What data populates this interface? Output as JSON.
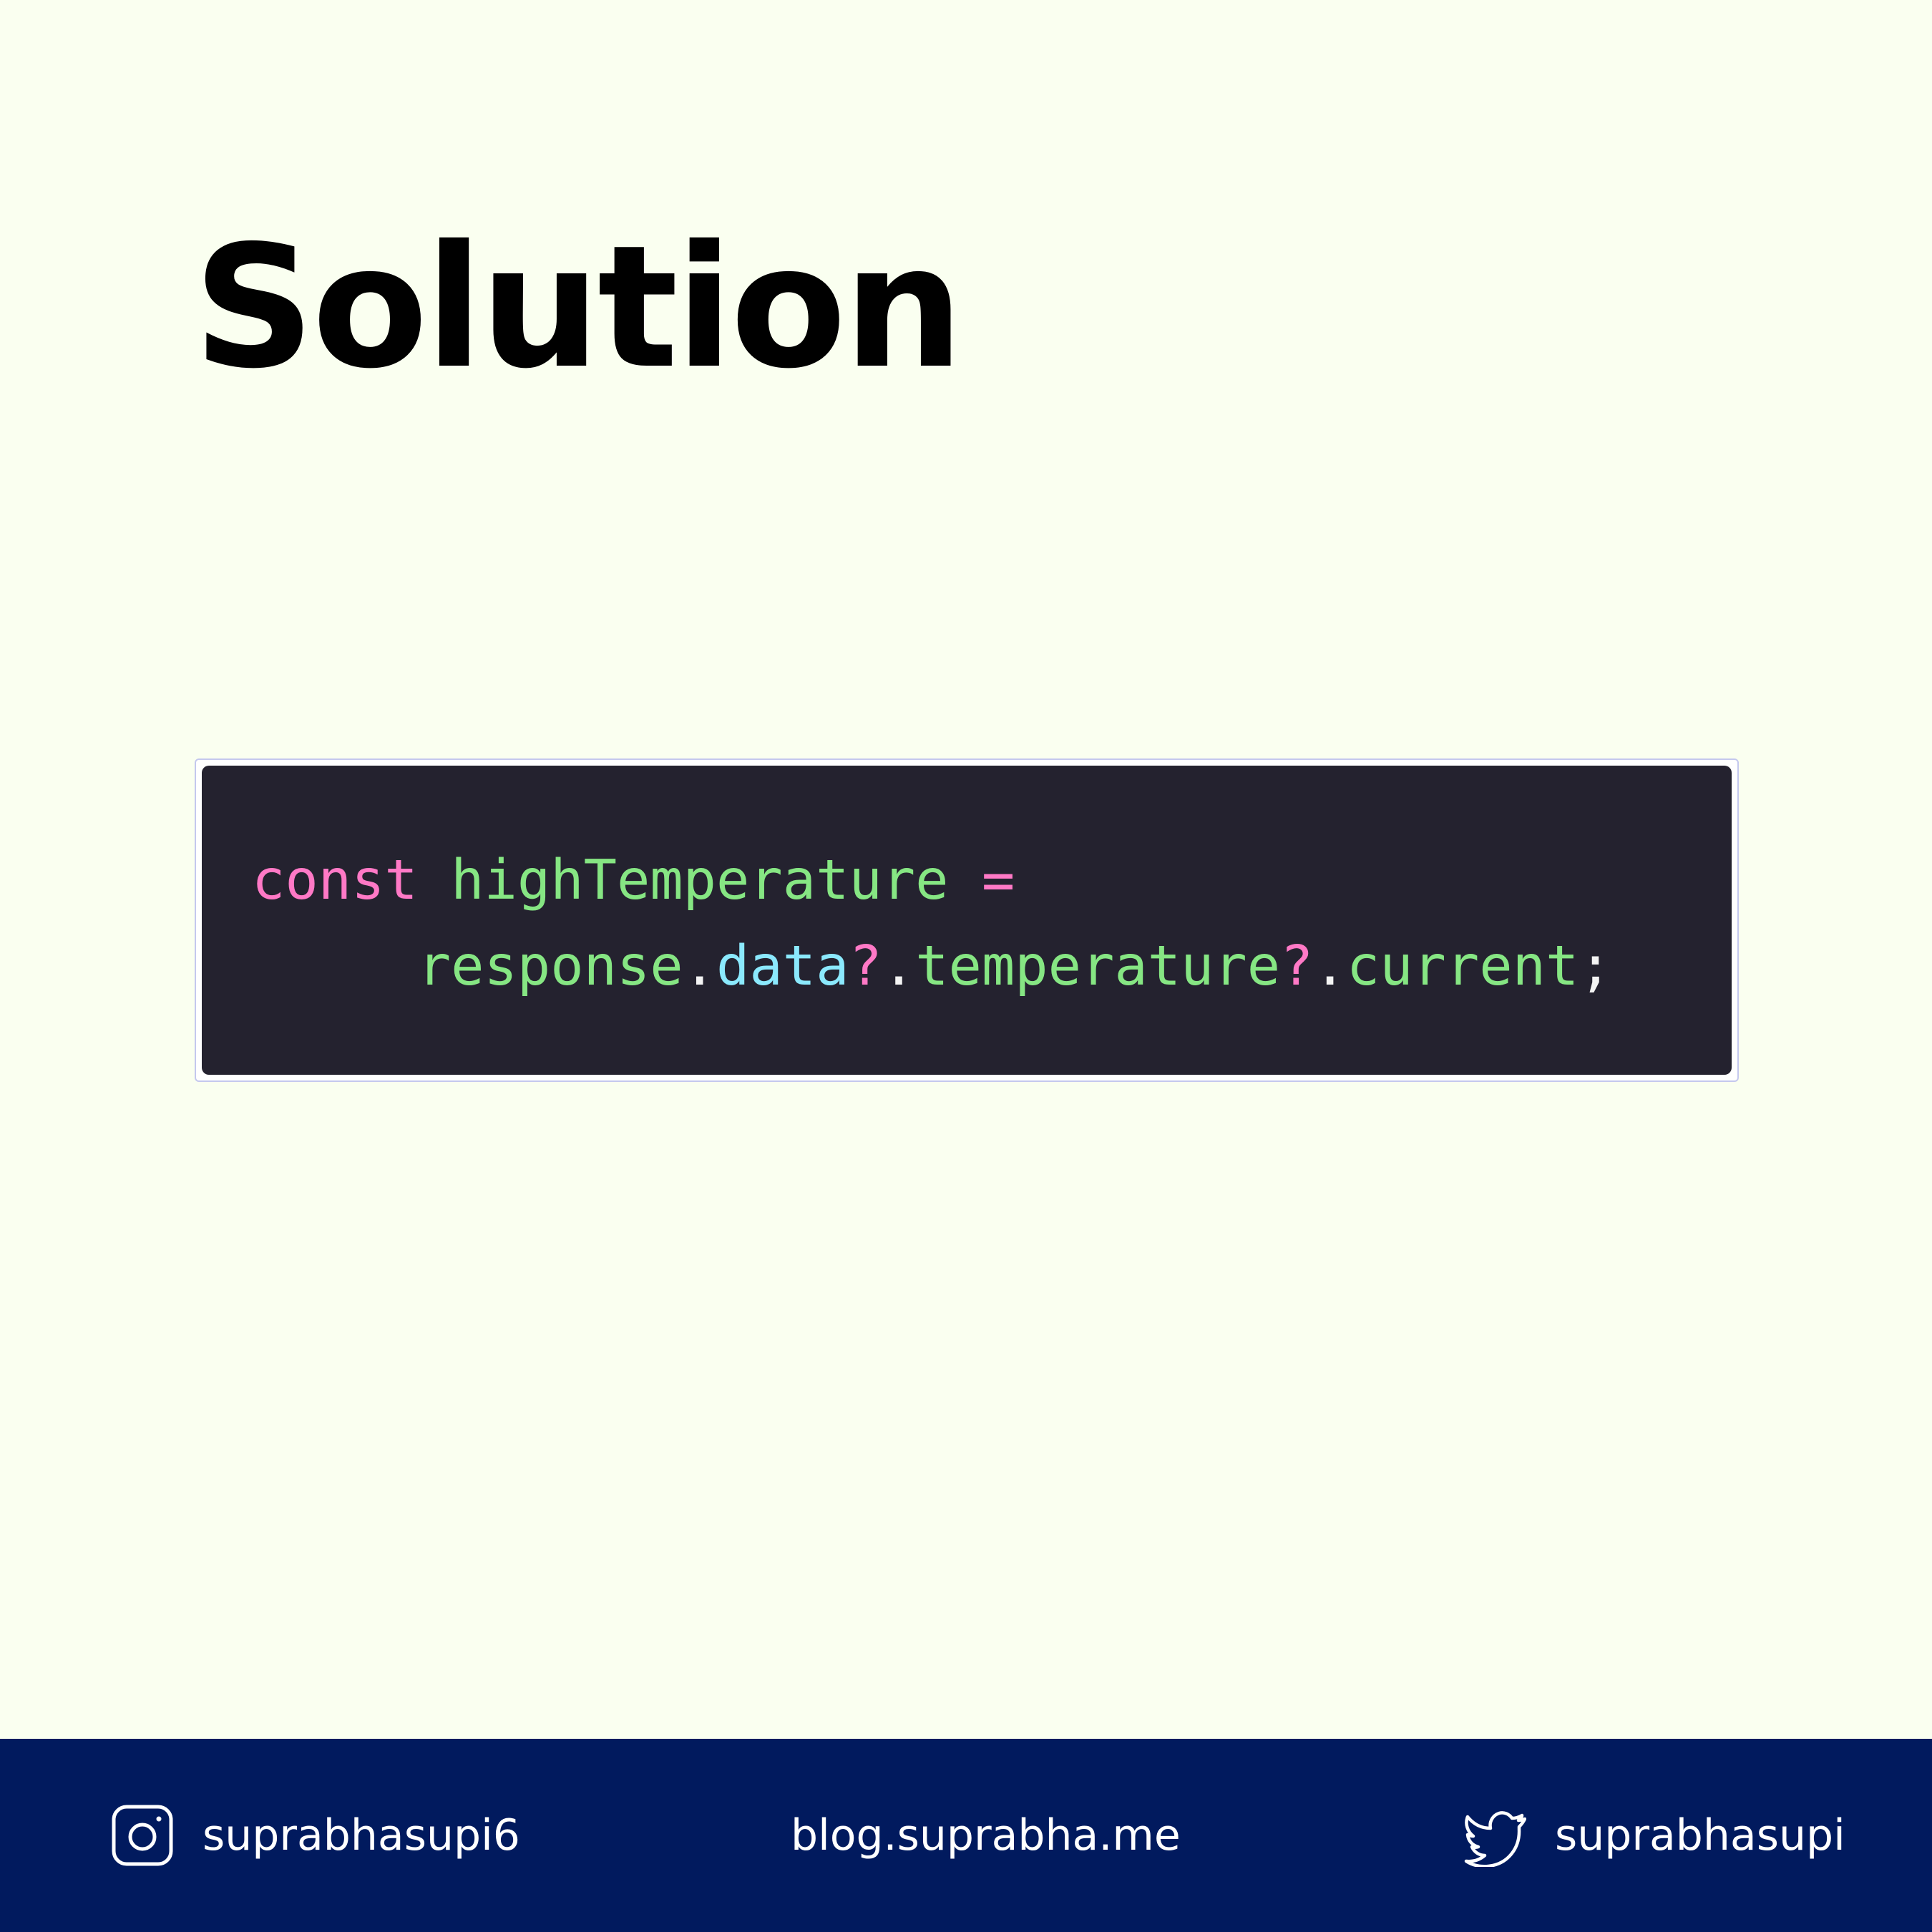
{
  "title": "Solution",
  "code": {
    "line1": {
      "keyword": "const",
      "variable": "highTemperature",
      "operator": "="
    },
    "line2": {
      "object": "response",
      "dot1": ".",
      "prop1": "data",
      "opt1": "?",
      "dot2": ".",
      "prop2": "temperature",
      "opt2": "?",
      "dot3": ".",
      "prop3": "current",
      "semicolon": ";"
    }
  },
  "footer": {
    "instagram": {
      "icon": "instagram-icon",
      "handle": "suprabhasupi6"
    },
    "blog": {
      "url": "blog.suprabha.me"
    },
    "twitter": {
      "icon": "twitter-icon",
      "handle": "suprabhasupi"
    }
  },
  "colors": {
    "background": "#fafff0",
    "code_background": "#24222f",
    "keyword": "#ff79c6",
    "identifier": "#86e683",
    "property": "#8be9fd",
    "footer_background": "#011a5e"
  }
}
